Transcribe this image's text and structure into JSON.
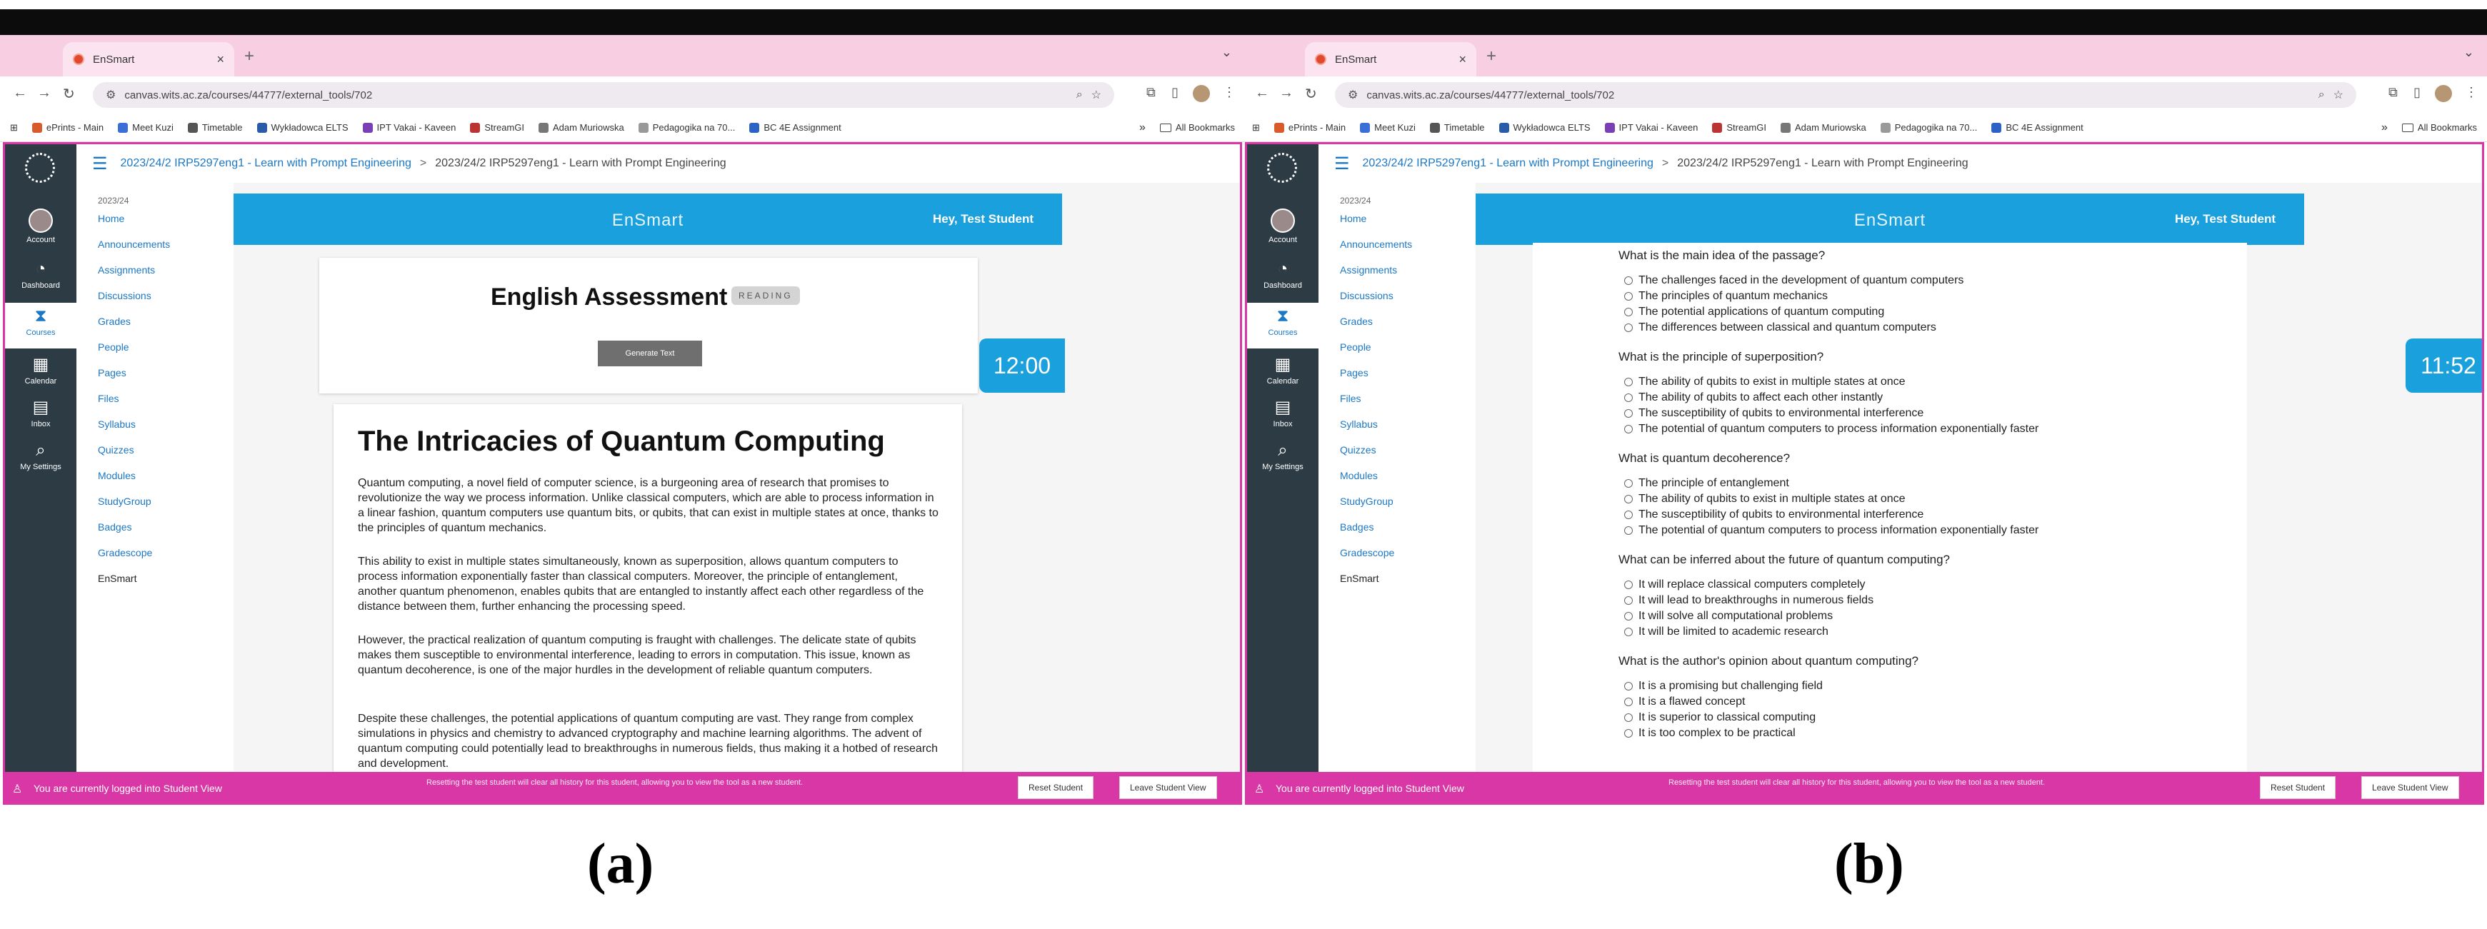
{
  "browser": {
    "tab_title": "EnSmart",
    "tab_close": "×",
    "new_tab": "+",
    "tab_chevron": "⌄",
    "url": "canvas.wits.ac.za/courses/44777/external_tools/702",
    "bookmarks": [
      "ePrints - Main",
      "Meet Kuzi",
      "Timetable",
      "Wykładowca ELTS",
      "IPT Vakai - Kaveen",
      "StreamGI",
      "Adam Muriowska",
      "Pedagogika na 70...",
      "BC 4E Assignment"
    ],
    "bookmarks_more": "»",
    "all_bookmarks": "All Bookmarks"
  },
  "breadcrumb": {
    "course": "2023/24/2 IRP5297eng1 - Learn with Prompt Engineering",
    "separator": ">",
    "current": "2023/24/2 IRP5297eng1 - Learn with Prompt Engineering"
  },
  "global_nav": [
    {
      "label": "Account",
      "icon": "avatar"
    },
    {
      "label": "Dashboard",
      "icon": "dashboard-icon"
    },
    {
      "label": "Courses",
      "icon": "courses-icon"
    },
    {
      "label": "Calendar",
      "icon": "calendar-icon"
    },
    {
      "label": "Inbox",
      "icon": "inbox-icon"
    },
    {
      "label": "My Settings",
      "icon": "search-icon"
    }
  ],
  "course_nav": {
    "term": "2023/24",
    "items": [
      "Home",
      "Announcements",
      "Assignments",
      "Discussions",
      "Grades",
      "People",
      "Pages",
      "Files",
      "Syllabus",
      "Quizzes",
      "Modules",
      "StudyGroup",
      "Badges",
      "Gradescope",
      "EnSmart"
    ]
  },
  "ensmart": {
    "title": "EnSmart",
    "greeting": "Hey, Test Student"
  },
  "panel_a": {
    "timer": "12:00",
    "assessment_title": "English Assessment",
    "badge": "READING",
    "generate_button": "Generate Text",
    "article_title": "The Intricacies of Quantum Computing",
    "paragraphs": [
      "Quantum computing, a novel field of computer science, is a burgeoning area of research that promises to revolutionize the way we process information. Unlike classical computers, which are able to process information in a linear fashion, quantum computers use quantum bits, or qubits, that can exist in multiple states at once, thanks to the principles of quantum mechanics.",
      "This ability to exist in multiple states simultaneously, known as superposition, allows quantum computers to process information exponentially faster than classical computers. Moreover, the principle of entanglement, another quantum phenomenon, enables qubits that are entangled to instantly affect each other regardless of the distance between them, further enhancing the processing speed.",
      "However, the practical realization of quantum computing is fraught with challenges. The delicate state of qubits makes them susceptible to environmental interference, leading to errors in computation. This issue, known as quantum decoherence, is one of the major hurdles in the development of reliable quantum computers.",
      "Despite these challenges, the potential applications of quantum computing are vast. They range from complex simulations in physics and chemistry to advanced cryptography and machine learning algorithms. The advent of quantum computing could potentially lead to breakthroughs in numerous fields, thus making it a hotbed of research and development."
    ]
  },
  "panel_b": {
    "timer": "11:52",
    "questions": [
      {
        "q": "What is the main idea of the passage?",
        "options": [
          "The challenges faced in the development of quantum computers",
          "The principles of quantum mechanics",
          "The potential applications of quantum computing",
          "The differences between classical and quantum computers"
        ]
      },
      {
        "q": "What is the principle of superposition?",
        "options": [
          "The ability of qubits to exist in multiple states at once",
          "The ability of qubits to affect each other instantly",
          "The susceptibility of qubits to environmental interference",
          "The potential of quantum computers to process information exponentially faster"
        ]
      },
      {
        "q": "What is quantum decoherence?",
        "options": [
          "The principle of entanglement",
          "The ability of qubits to exist in multiple states at once",
          "The susceptibility of qubits to environmental interference",
          "The potential of quantum computers to process information exponentially faster"
        ]
      },
      {
        "q": "What can be inferred about the future of quantum computing?",
        "options": [
          "It will replace classical computers completely",
          "It will lead to breakthroughs in numerous fields",
          "It will solve all computational problems",
          "It will be limited to academic research"
        ]
      },
      {
        "q": "What is the author's opinion about quantum computing?",
        "options": [
          "It is a promising but challenging field",
          "It is a flawed concept",
          "It is superior to classical computing",
          "It is too complex to be practical"
        ]
      }
    ]
  },
  "student_view": {
    "message": "You are currently logged into Student View",
    "note": "Resetting the test student will clear all history for this student, allowing you to view the tool as a new student.",
    "reset_button": "Reset Student",
    "leave_button": "Leave Student View"
  },
  "captions": {
    "a": "(a)",
    "b": "(b)"
  },
  "colors": {
    "brand_blue": "#1aa0dc",
    "link_blue": "#1b78c6",
    "student_view_magenta": "#d937a5",
    "nav_dark": "#2d3b45",
    "tabstrip_pink": "#f8cfe2"
  }
}
